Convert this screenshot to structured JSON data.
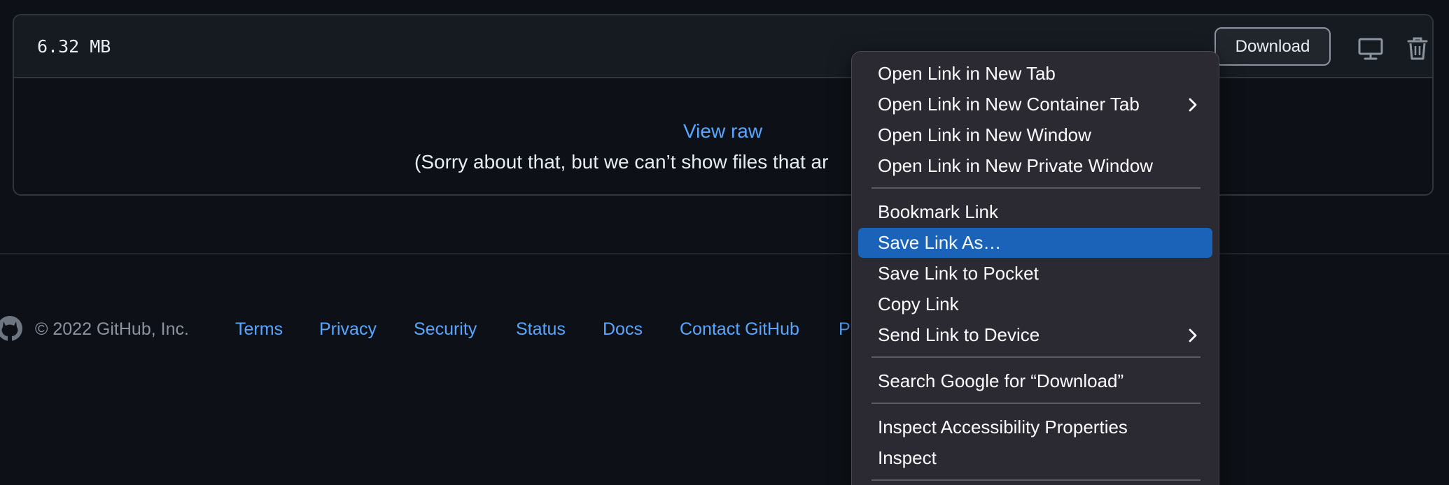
{
  "file": {
    "size": "6.32 MB",
    "download_label": "Download",
    "view_raw": "View raw",
    "message": "(Sorry about that, but we can’t show files that ar"
  },
  "footer": {
    "copyright": "© 2022 GitHub, Inc.",
    "links": [
      "Terms",
      "Privacy",
      "Security",
      "Status",
      "Docs",
      "Contact GitHub",
      "P"
    ]
  },
  "context_menu": {
    "items": [
      {
        "label": "Open Link in New Tab",
        "submenu": false
      },
      {
        "label": "Open Link in New Container Tab",
        "submenu": true
      },
      {
        "label": "Open Link in New Window",
        "submenu": false
      },
      {
        "label": "Open Link in New Private Window",
        "submenu": false
      },
      {
        "label": "Bookmark Link",
        "submenu": false
      },
      {
        "label": "Save Link As…",
        "submenu": false,
        "highlighted": true
      },
      {
        "label": "Save Link to Pocket",
        "submenu": false
      },
      {
        "label": "Copy Link",
        "submenu": false
      },
      {
        "label": "Send Link to Device",
        "submenu": true
      },
      {
        "label": "Search Google for “Download”",
        "submenu": false
      },
      {
        "label": "Inspect Accessibility Properties",
        "submenu": false
      },
      {
        "label": "Inspect",
        "submenu": false
      }
    ]
  },
  "icons": {
    "desktop": "desktop-icon",
    "trash": "trash-icon",
    "github": "github-logo-icon",
    "submenu": "chevron-right-icon"
  },
  "colors": {
    "background": "#0d1117",
    "header": "#161b22",
    "border": "#30363d",
    "link": "#58a6ff",
    "menu_bg": "#2b2a33",
    "menu_highlight": "#1a63b8"
  }
}
